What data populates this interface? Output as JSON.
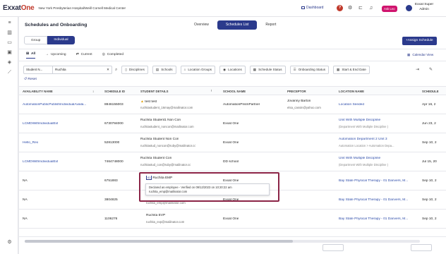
{
  "topbar": {
    "logo_main": "Exxat",
    "logo_accent": "One",
    "hospital": "New York Presbyterian Hospital/Weill Cornell Medical Center",
    "dashboard": "Dashboard",
    "help": "?",
    "ask_leo": "Ask Leo",
    "user_line1": "Exxat Super",
    "user_line2": "Admin"
  },
  "page": {
    "title": "Schedules and Onboarding",
    "views": [
      "Overview",
      "Schedules List",
      "Report"
    ],
    "toggle": [
      "Group",
      "Individual"
    ],
    "assign_button": "+Assign Schedule",
    "tabs": [
      "All",
      "Upcoming",
      "Current",
      "Completed"
    ],
    "calendar_view": "Calendar View",
    "reset": "Reset"
  },
  "filters": {
    "field_select": "Student N...",
    "search_value": "Ruchita",
    "chips": [
      "Disciplines",
      "Schools",
      "Location Groups",
      "Locations",
      "Schedule Status",
      "Onboarding Status",
      "Start & End Date"
    ]
  },
  "columns": [
    "AVAILABILITY NAME",
    "SCHEDULE ID",
    "STUDENT DETAILS",
    "SCHOOL NAME",
    "PRECEPTOR",
    "LOCATION NAME",
    "SCHEDULE"
  ],
  "rows": [
    {
      "availability": "AutomationPublicPublishIndividualAvaila...",
      "id": "8846155003",
      "student": "test test",
      "student_email": "ruchitastudent_16may@mailinator.com",
      "school": "AutomationPrismPartner",
      "preceptor": "Jovanny Barton",
      "preceptor_email": "elsa_cassin@yahoo.com",
      "location": "Location Seeded",
      "location_sub": "",
      "date": "Apr 16, 2"
    },
    {
      "availability": "LCMDWithIndividualExt",
      "id": "6730784000",
      "student": "Ruchita Student1 Non Con",
      "student_email": "ruchitastudent_noncon@mailinator.com",
      "school": "Exxat One",
      "preceptor": "",
      "preceptor_email": "",
      "location": "Unit With Multiple Discipline",
      "location_sub": "(Department With Multiple Discipline )",
      "date": "Jun 23, 2"
    },
    {
      "availability": "Hello_Rex",
      "id": "52813000",
      "student": "Ruchita Student Non Con",
      "student_email": "ruchitastud_noncon@ruby@mailinator.cc",
      "school": "Exxat One",
      "preceptor": "",
      "preceptor_email": "",
      "location": "Automation Department 2 Unit 3",
      "location_sub": "Automation Location > Automation Depa...",
      "date": "Sep 10, 2"
    },
    {
      "availability": "LCMDWithIndividualExt",
      "id": "7464748000",
      "student": "Ruchita Student Con",
      "student_email": "ruchitastud_con@ruby@mailinator.cc",
      "school": "DD school",
      "preceptor": "",
      "preceptor_email": "",
      "location": "Unit With Multiple Discipline",
      "location_sub": "(Department With Multiple Discipline )",
      "date": "Jul 15, 20"
    },
    {
      "availability": "NA",
      "id": "6751883",
      "student": "Ruchita EMP",
      "student_email": "",
      "school": "Exxat One",
      "preceptor": "",
      "preceptor_email": "",
      "location": "Bay State Physical Therapy - 01 Danvers, M...",
      "location_sub": "",
      "date": "Sep 10, 2"
    },
    {
      "availability": "NA",
      "id": "3804825",
      "student": "",
      "student_email": "ruchita_emp@mailinator.com",
      "school": "Exxat One",
      "preceptor": "",
      "preceptor_email": "",
      "location": "Bay State Physical Therapy - 01 Danvers, M...",
      "location_sub": "",
      "date": "Sep 10, 2"
    },
    {
      "availability": "NA",
      "id": "1106276",
      "student": "Ruchita EVP",
      "student_email": "ruchita_evp@mailinator.com",
      "school": "Exxat One",
      "preceptor": "",
      "preceptor_email": "",
      "location": "Bay State Physical Therapy - 01 Danvers, M...",
      "location_sub": "",
      "date": "Sep 10, 2"
    }
  ],
  "tooltip": {
    "line1": "Declared as employee - Verified on 09/12/2023 on 10:20:22 am",
    "line2": "ruchita_emp@mailinator.com"
  },
  "colors": {
    "primary": "#2b3a8c",
    "ask_leo": "#d0146e",
    "highlight": "#8b2447",
    "link": "#2b4aa8"
  }
}
